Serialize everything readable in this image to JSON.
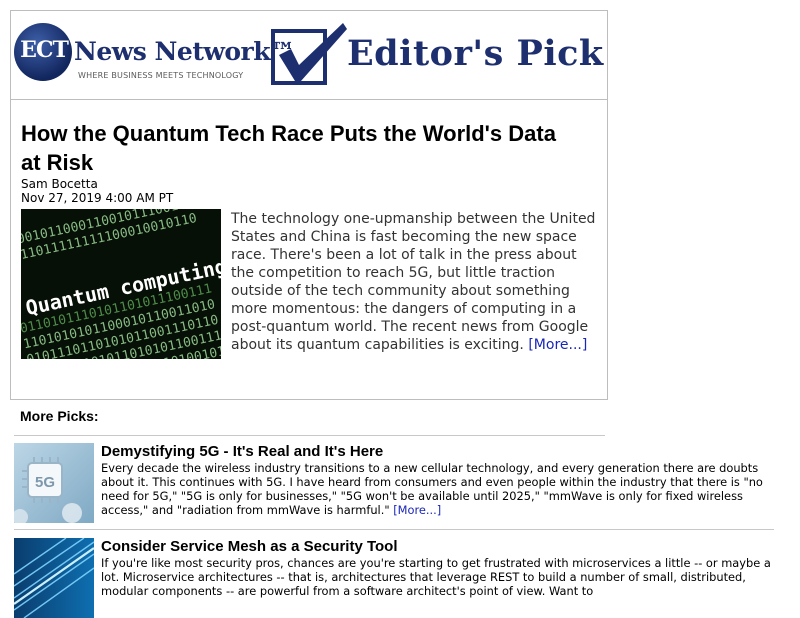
{
  "header": {
    "logo_mark": "ECT",
    "logo_name": "News Network™",
    "logo_tagline": "WHERE BUSINESS MEETS TECHNOLOGY",
    "badge_label": "Editor's Pick"
  },
  "article": {
    "title": "How the Quantum Tech Race Puts the World's Data at Risk",
    "author": "Sam Bocetta",
    "date": "Nov 27, 2019 4:00 AM PT",
    "summary": "The technology one-upmanship between the United States and China is fast becoming the new space race. There's been a lot of talk in the press about the competition to reach 5G, but little traction outside of the tech community about something more momentous: the dangers of computing in a post-quantum world. The recent news from Google about its quantum capabilities is exciting.",
    "more_link": "[More...]",
    "image_text": "Quantum computing",
    "image_icon": "quantum-computing-image"
  },
  "more_picks": {
    "heading": "More Picks:",
    "items": [
      {
        "title": "Demystifying 5G - It's Real and It's Here",
        "text": "Every decade the wireless industry transitions to a new cellular technology, and every generation there are doubts about it. This continues with 5G. I have heard from consumers and even people within the industry that there is \"no need for 5G,\" \"5G is only for businesses,\" \"5G won't be available until 2025,\" \"mmWave is only for fixed wireless access,\" and \"radiation from mmWave is harmful.\"",
        "more_link": "[More...]",
        "thumb_label": "5G",
        "thumb_icon": "5g-chip-image"
      },
      {
        "title": "Consider Service Mesh as a Security Tool",
        "text": "If you're like most security pros, chances are you're starting to get frustrated with microservices a little -- or maybe a lot. Microservice architectures -- that is, architectures that leverage REST to build a number of small, distributed, modular components -- are powerful from a software architect's point of view. Want to",
        "thumb_icon": "circuit-light-image"
      }
    ]
  },
  "colors": {
    "brand_navy": "#1d2f6e",
    "link_blue": "#1a26b6",
    "divider": "#c8c8c8"
  }
}
